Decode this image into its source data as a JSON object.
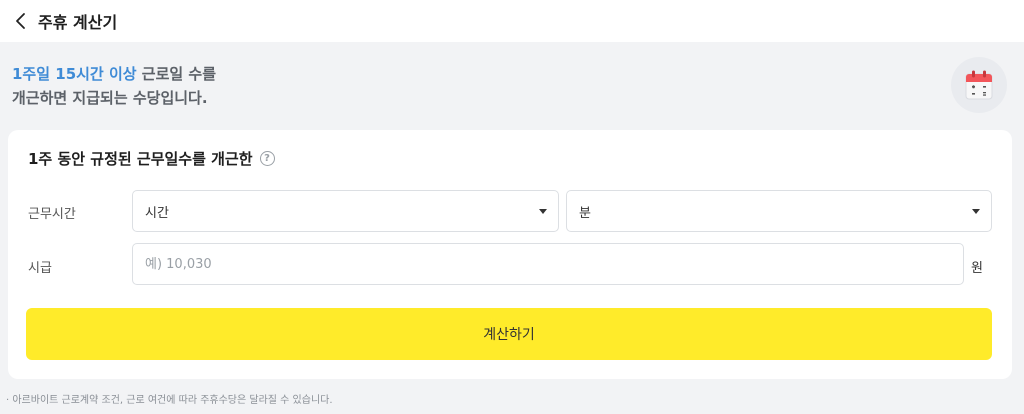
{
  "header": {
    "title": "주휴 계산기",
    "back_icon": "chevron-left-icon"
  },
  "intro": {
    "highlight": "1주일 15시간 이상",
    "line1_rest": " 근로일 수를",
    "line2": "개근하면 지급되는 수당입니다.",
    "icon": "calendar-icon"
  },
  "form": {
    "title": "1주 동안 규정된 근무일수를 개근한",
    "help_icon": "question-icon",
    "hours_label": "근무시간",
    "hours_select": "시간",
    "minutes_select": "분",
    "wage_label": "시급",
    "wage_placeholder": "예) 10,030",
    "wage_unit": "원",
    "submit_label": "계산하기"
  },
  "footnote": "· 아르바이트 근로계약 조건, 근로 여건에 따라 주휴수당은 달라질 수 있습니다.",
  "colors": {
    "accent": "#3f8bd6",
    "button": "#ffeb2a",
    "background": "#f2f3f5"
  }
}
